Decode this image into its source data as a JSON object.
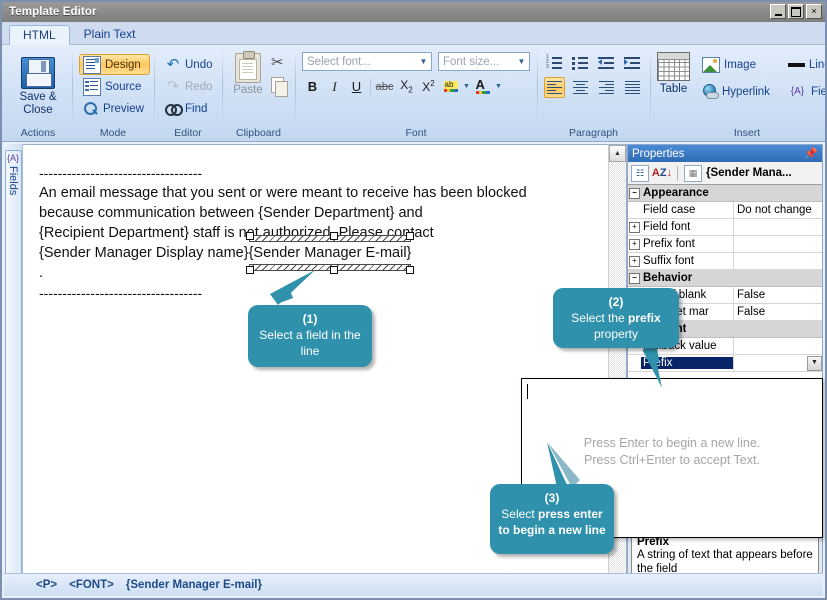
{
  "window": {
    "title": "Template Editor",
    "buttons": {
      "minimize": "minimize-icon",
      "maximize": "maximize-icon",
      "close": "×"
    }
  },
  "tabs": [
    {
      "label": "HTML",
      "active": true
    },
    {
      "label": "Plain Text",
      "active": false
    }
  ],
  "ribbon": {
    "groups": [
      {
        "name": "Actions",
        "label": "Actions",
        "items": [
          {
            "label": "Save & Close",
            "icon": "floppy-disk-icon"
          }
        ]
      },
      {
        "name": "Mode",
        "label": "Mode",
        "items": [
          {
            "label": "Design",
            "icon": "design-view-icon",
            "selected": true
          },
          {
            "label": "Source",
            "icon": "source-view-icon",
            "selected": false
          },
          {
            "label": "Preview",
            "icon": "magnifier-icon",
            "selected": false
          }
        ]
      },
      {
        "name": "Editor",
        "label": "Editor",
        "items": [
          {
            "label": "Undo",
            "icon": "undo-arrow-icon",
            "disabled": false
          },
          {
            "label": "Redo",
            "icon": "redo-arrow-icon",
            "disabled": true
          },
          {
            "label": "Find",
            "icon": "binoculars-icon",
            "disabled": false
          }
        ]
      },
      {
        "name": "Clipboard",
        "label": "Clipboard",
        "items": [
          {
            "label": "Paste",
            "icon": "clipboard-icon",
            "disabled": true
          },
          {
            "label": "",
            "icon": "scissors-icon"
          },
          {
            "label": "",
            "icon": "copy-icon"
          }
        ]
      },
      {
        "name": "Font",
        "label": "Font",
        "font_combo_placeholder": "Select font...",
        "size_combo_placeholder": "Font size...",
        "buttons": [
          {
            "label": "B",
            "name": "bold"
          },
          {
            "label": "I",
            "name": "italic"
          },
          {
            "label": "U",
            "name": "underline"
          },
          {
            "label": "abc",
            "name": "strikethrough"
          },
          {
            "label": "X2",
            "name": "subscript"
          },
          {
            "label": "X2",
            "name": "superscript"
          },
          {
            "label": "ab",
            "name": "text-highlight"
          },
          {
            "label": "A",
            "name": "font-color"
          }
        ]
      },
      {
        "name": "Paragraph",
        "label": "Paragraph",
        "buttons": [
          {
            "name": "numbered-list"
          },
          {
            "name": "bulleted-list"
          },
          {
            "name": "decrease-indent"
          },
          {
            "name": "increase-indent"
          },
          {
            "name": "align-left",
            "selected": true
          },
          {
            "name": "align-center"
          },
          {
            "name": "align-right"
          },
          {
            "name": "align-justify"
          }
        ]
      },
      {
        "name": "Insert",
        "label": "Insert",
        "items": [
          {
            "label": "Table",
            "icon": "table-icon"
          },
          {
            "label": "Image",
            "icon": "image-icon"
          },
          {
            "label": "Line",
            "icon": "horizontal-line-icon"
          },
          {
            "label": "Hyperlink",
            "icon": "globe-link-icon"
          },
          {
            "label": "Fields",
            "icon": "field-braces-icon",
            "has_dropdown": true
          }
        ]
      }
    ]
  },
  "left_rail": {
    "tab_label": "Fields",
    "tab_icon": "{A}"
  },
  "document": {
    "rule_top": "-----------------------------------",
    "line1": "An email message that you sent or were meant to receive has been blocked",
    "line2": "because communication between {Sender Department} and",
    "line3_a": "{Recipient Department} staff is not authorized. Please contact",
    "line4_a": "{Sender Manager Display name}",
    "line4_field": "{Sender Manager E-mail}",
    "line5": ".",
    "rule_bottom": "-----------------------------------"
  },
  "properties": {
    "title": "Properties",
    "pin_icon": "pin-icon",
    "toolbar": {
      "categorized_icon": "categorized-view-icon",
      "alphabetical_icon": "alphabetical-sort-icon",
      "page_icon": "property-pages-icon",
      "object_name": "{Sender Mana..."
    },
    "rows": [
      {
        "type": "category",
        "name": "Appearance",
        "expander": "-"
      },
      {
        "type": "row",
        "name": "Field case",
        "value": "Do not change"
      },
      {
        "type": "row",
        "name": "Field font",
        "value": "",
        "expander": "+"
      },
      {
        "type": "row",
        "name": "Prefix font",
        "value": "",
        "expander": "+"
      },
      {
        "type": "row",
        "name": "Suffix font",
        "value": "",
        "expander": "+"
      },
      {
        "type": "category",
        "name": "Behavior",
        "expander": "-"
      },
      {
        "type": "row",
        "name": "Hide if blank",
        "value": "False"
      },
      {
        "type": "row",
        "name": "Interpret mar",
        "value": "False"
      },
      {
        "type": "category",
        "name": "Content",
        "expander": "-"
      },
      {
        "type": "row",
        "name": "Fallback value",
        "value": ""
      },
      {
        "type": "row",
        "name": "Prefix",
        "value": "",
        "selected": true,
        "has_dropdown": true
      }
    ],
    "description": {
      "title": "Prefix",
      "text": "A string of text that appears before the field"
    }
  },
  "popup_editor": {
    "hint_line1": "Press Enter to begin a new line.",
    "hint_line2": "Press Ctrl+Enter to accept Text."
  },
  "status_bar": {
    "items": [
      "<P>",
      "<FONT>",
      "{Sender Manager E-mail}"
    ]
  },
  "callouts": [
    {
      "number": "(1)",
      "text": "Select a field in the line"
    },
    {
      "number": "(2)",
      "text_pre": "Select the ",
      "text_bold": "prefix",
      "text_post": " property"
    },
    {
      "number": "(3)",
      "text_pre": "Select ",
      "text_bold": "press enter to begin a new line",
      "text_post": ""
    }
  ],
  "colors": {
    "accent": "#2f91ab",
    "titlebar": "#8c8c8c",
    "ribbon": "#cfe0f5",
    "selection": "#0a246a",
    "highlight": "#ffc85f"
  }
}
